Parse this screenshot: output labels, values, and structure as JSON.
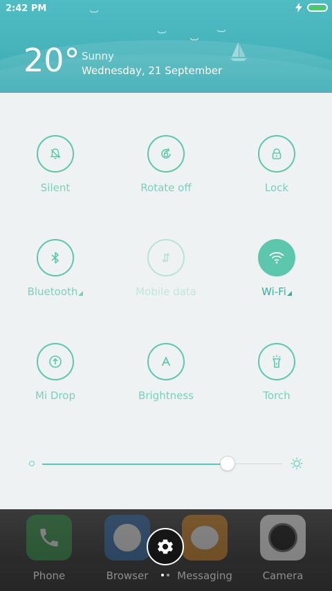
{
  "status": {
    "time": "2:42 PM"
  },
  "weather": {
    "temperature": "20°",
    "condition": "Sunny",
    "date": "Wednesday, 21 September"
  },
  "toggles": [
    {
      "label": "Silent",
      "icon": "bell-off-icon",
      "state": "off"
    },
    {
      "label": "Rotate off",
      "icon": "rotate-lock-icon",
      "state": "off"
    },
    {
      "label": "Lock",
      "icon": "lock-icon",
      "state": "off"
    },
    {
      "label": "Bluetooth",
      "icon": "bluetooth-icon",
      "state": "off",
      "expandable": true
    },
    {
      "label": "Mobile data",
      "icon": "mobile-data-icon",
      "state": "disabled"
    },
    {
      "label": "Wi-Fi",
      "icon": "wifi-icon",
      "state": "on",
      "expandable": true
    },
    {
      "label": "Mi Drop",
      "icon": "mi-drop-icon",
      "state": "off"
    },
    {
      "label": "Brightness",
      "icon": "brightness-auto-icon",
      "state": "off"
    },
    {
      "label": "Torch",
      "icon": "torch-icon",
      "state": "off"
    }
  ],
  "brightness": {
    "level": 0.77
  },
  "dock": {
    "apps": [
      {
        "label": "Phone",
        "icon": "phone-icon"
      },
      {
        "label": "Browser",
        "icon": "browser-icon"
      },
      {
        "label": "Messaging",
        "icon": "messaging-icon"
      },
      {
        "label": "Camera",
        "icon": "camera-icon"
      }
    ],
    "page_indicator": {
      "pages": 2,
      "current": 1
    }
  },
  "colors": {
    "accent": "#5cc7ad",
    "header": "#46b3ba",
    "panel": "#eef2f2"
  }
}
